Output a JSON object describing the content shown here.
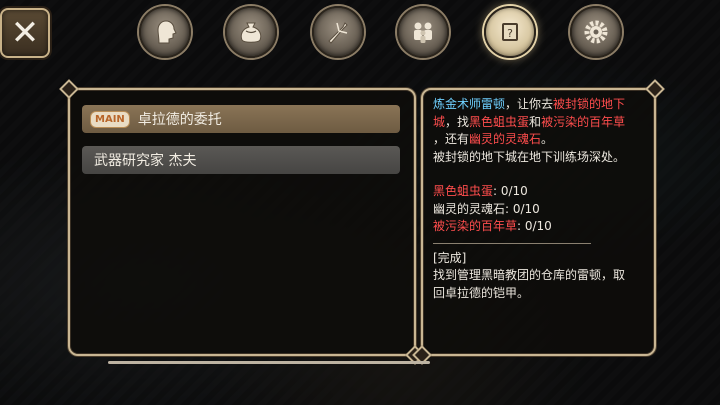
{
  "close_button": {
    "label": "✕",
    "icon": "close-icon"
  },
  "tabs": [
    {
      "icon": "character-head-icon",
      "active": false
    },
    {
      "icon": "inventory-bag-icon",
      "active": false
    },
    {
      "icon": "skill-sword-icon",
      "active": false
    },
    {
      "icon": "party-group-icon",
      "active": false
    },
    {
      "icon": "quest-scroll-icon",
      "active": true
    },
    {
      "icon": "settings-gear-icon",
      "active": false
    }
  ],
  "quest_list": [
    {
      "badge": "MAIN",
      "title": "卓拉德的委托",
      "selected": true
    },
    {
      "badge": "",
      "title": "武器研究家 杰夫",
      "selected": false
    }
  ],
  "detail": {
    "line1_a": "炼金术师雷顿",
    "line1_b": "，让你去",
    "line1_c": "被封锁的地下",
    "line2_a": "城",
    "line2_b": "，找",
    "line2_c": "黑色蛆虫蛋",
    "line2_d": "和",
    "line2_e": "被污染的百年草",
    "line3_a": "，还有",
    "line3_b": "幽灵的灵魂石",
    "line3_c": "。",
    "line4_a": "被封锁的地下城",
    "line4_b": "在地下训练场深处。",
    "progress": [
      {
        "name": "黑色蛆虫蛋",
        "value": ": 0/10"
      },
      {
        "name": "幽灵的灵魂石",
        "value": ": 0/10"
      },
      {
        "name": "被污染的百年草",
        "value": ": 0/10"
      }
    ],
    "complete_header": "[完成]",
    "complete_line1": "找到管理黑暗教团的仓库的雷顿，取",
    "complete_line2": "回卓拉德的铠甲。"
  },
  "colors": {
    "accent_blue": "#6fd0ff",
    "accent_red": "#ff4d4d",
    "frame": "#c9b693"
  }
}
